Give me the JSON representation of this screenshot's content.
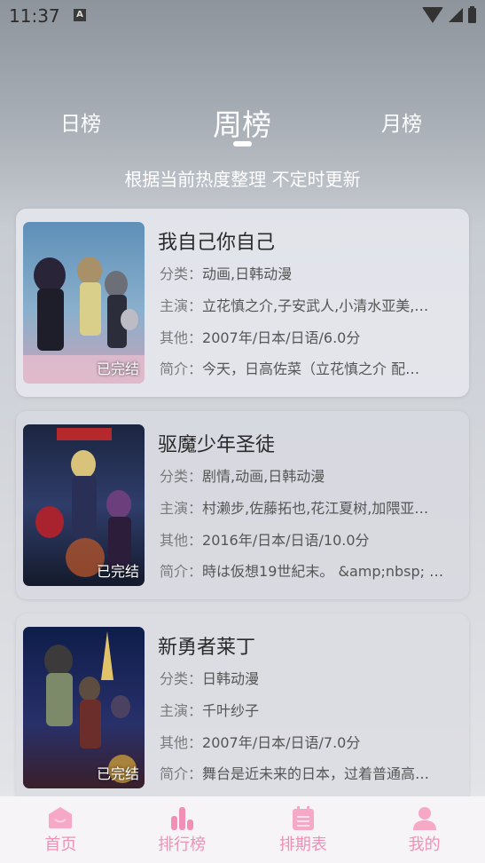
{
  "status_bar": {
    "time": "11:37",
    "notification_letter": "A"
  },
  "tabs": [
    {
      "label": "日榜",
      "active": false
    },
    {
      "label": "周榜",
      "active": true
    },
    {
      "label": "月榜",
      "active": false
    }
  ],
  "subtitle": "根据当前热度整理 不定时更新",
  "labels": {
    "category": "分类：",
    "cast": "主演：",
    "other": "其他：",
    "intro": "简介："
  },
  "items": [
    {
      "title": "我自己你自己",
      "category": "动画,日韩动漫",
      "cast": "立花慎之介,子安武人,小清水亚美,…",
      "other": "2007年/日本/日语/6.0分",
      "intro": "今天，日高佐菜（立花慎之介 配…",
      "badge": "已完结"
    },
    {
      "title": "驱魔少年圣徒",
      "category": "剧情,动画,日韩动漫",
      "cast": "村濑步,佐藤拓也,花江夏树,加隈亚…",
      "other": "2016年/日本/日语/10.0分",
      "intro": "時は仮想19世紀末。 &amp;nbsp; …",
      "badge": "已完结"
    },
    {
      "title": "新勇者莱丁",
      "category": "日韩动漫",
      "cast": "千叶纱子",
      "other": "2007年/日本/日语/7.0分",
      "intro": "舞台是近未来的日本，过着普通高…",
      "badge": "已完结"
    }
  ],
  "nav": [
    {
      "label": "首页",
      "icon": "home-icon"
    },
    {
      "label": "排行榜",
      "icon": "ranking-icon"
    },
    {
      "label": "排期表",
      "icon": "schedule-icon"
    },
    {
      "label": "我的",
      "icon": "profile-icon"
    }
  ],
  "colors": {
    "accent": "#f28fb6",
    "active_tab": "#ffffff"
  }
}
